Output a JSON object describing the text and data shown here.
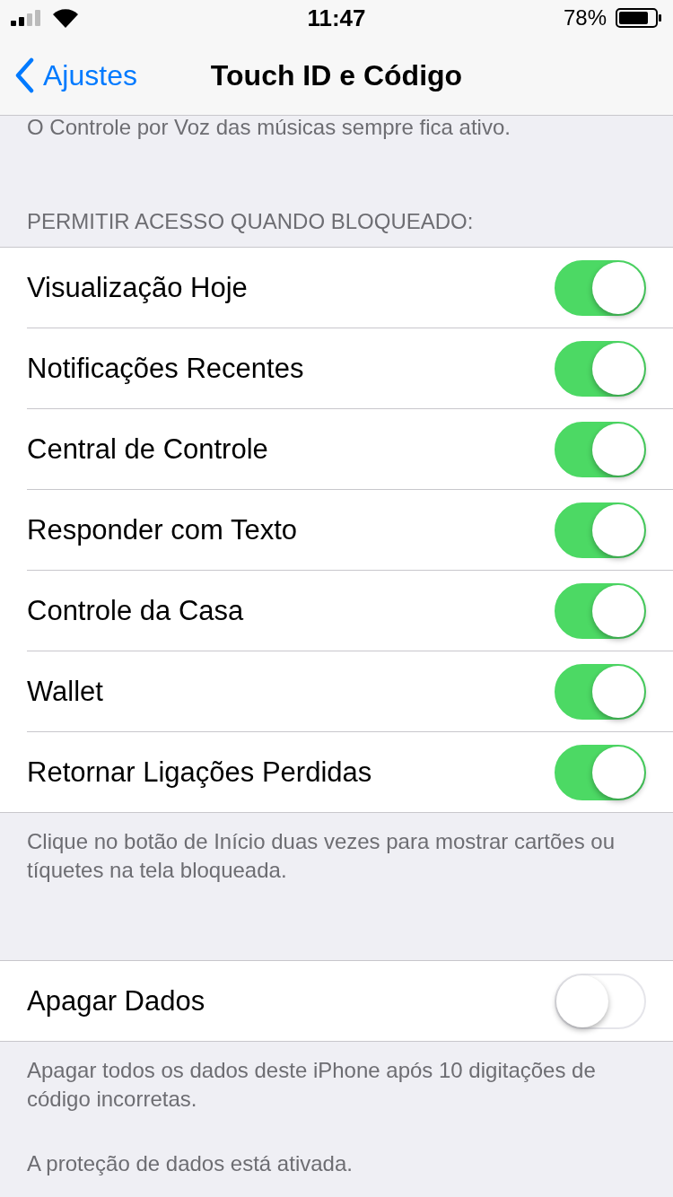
{
  "status_bar": {
    "time": "11:47",
    "battery": "78%"
  },
  "nav": {
    "back": "Ajustes",
    "title": "Touch ID e Código"
  },
  "top_note": "O Controle por Voz das músicas sempre fica ativo.",
  "sections": [
    {
      "header": "PERMITIR ACESSO QUANDO BLOQUEADO:",
      "rows": [
        {
          "label": "Visualização Hoje",
          "on": true
        },
        {
          "label": "Notificações Recentes",
          "on": true
        },
        {
          "label": "Central de Controle",
          "on": true
        },
        {
          "label": "Responder com Texto",
          "on": true
        },
        {
          "label": "Controle da Casa",
          "on": true
        },
        {
          "label": "Wallet",
          "on": true
        },
        {
          "label": "Retornar Ligações Perdidas",
          "on": true
        }
      ],
      "footer": [
        "Clique no botão de Início duas vezes para mostrar cartões ou tíquetes na tela bloqueada."
      ]
    },
    {
      "rows": [
        {
          "label": "Apagar Dados",
          "on": false
        }
      ],
      "footer": [
        "Apagar todos os dados deste iPhone após 10 digitações de código incorretas.",
        "A proteção de dados está ativada."
      ]
    }
  ]
}
